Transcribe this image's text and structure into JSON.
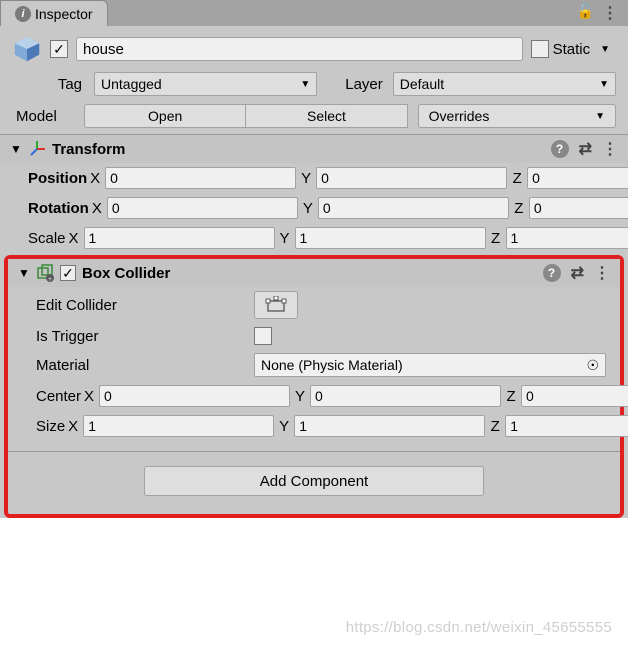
{
  "tab": {
    "title": "Inspector"
  },
  "gameObject": {
    "enabled_mark": "✓",
    "name": "house",
    "static_label": "Static"
  },
  "tagRow": {
    "tag_lbl": "Tag",
    "tag_value": "Untagged",
    "layer_lbl": "Layer",
    "layer_value": "Default"
  },
  "modelRow": {
    "lbl": "Model",
    "open": "Open",
    "select": "Select",
    "overrides": "Overrides"
  },
  "transform": {
    "title": "Transform",
    "position": {
      "lbl": "Position",
      "x": "0",
      "y": "0",
      "z": "0"
    },
    "rotation": {
      "lbl": "Rotation",
      "x": "0",
      "y": "0",
      "z": "0"
    },
    "scale": {
      "lbl": "Scale",
      "x": "1",
      "y": "1",
      "z": "1"
    }
  },
  "boxCollider": {
    "title": "Box Collider",
    "enabled_mark": "✓",
    "editCollider_lbl": "Edit Collider",
    "isTrigger_lbl": "Is Trigger",
    "material_lbl": "Material",
    "material_value": "None (Physic Material)",
    "center": {
      "lbl": "Center",
      "x": "0",
      "y": "0",
      "z": "0"
    },
    "size": {
      "lbl": "Size",
      "x": "1",
      "y": "1",
      "z": "1"
    }
  },
  "axes": {
    "x": "X",
    "y": "Y",
    "z": "Z"
  },
  "addComponent": "Add Component",
  "watermark": "https://blog.csdn.net/weixin_45655555"
}
